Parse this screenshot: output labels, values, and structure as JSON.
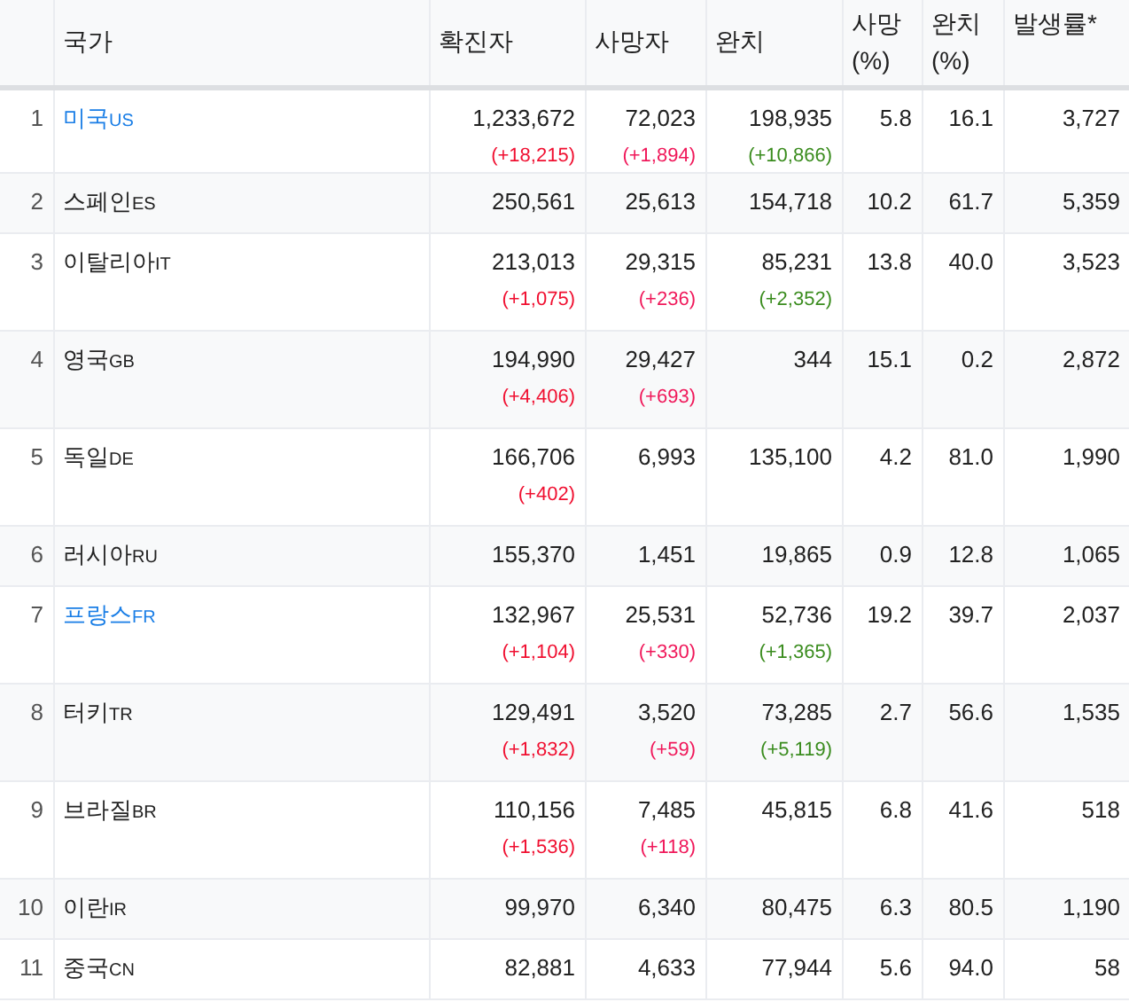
{
  "columns": [
    {},
    {
      "label": "국가"
    },
    {
      "label": "확진자"
    },
    {
      "label": "사망자"
    },
    {
      "label": "완치"
    },
    {
      "label": "사망 (%)"
    },
    {
      "label": "완치 (%)"
    },
    {
      "label": "발생률*"
    }
  ],
  "rows": [
    {
      "rank": "1",
      "name": "미국",
      "code": "US",
      "link": true,
      "cases": "1,233,672",
      "cases_new": "(+18,215)",
      "deaths": "72,023",
      "deaths_new": "(+1,894)",
      "recovered": "198,935",
      "recovered_new": "(+10,866)",
      "death_pct": "5.8",
      "recovered_pct": "16.1",
      "rate": "3,727"
    },
    {
      "rank": "2",
      "name": "스페인",
      "code": "ES",
      "link": false,
      "cases": "250,561",
      "deaths": "25,613",
      "recovered": "154,718",
      "death_pct": "10.2",
      "recovered_pct": "61.7",
      "rate": "5,359"
    },
    {
      "rank": "3",
      "name": "이탈리아",
      "code": "IT",
      "link": false,
      "cases": "213,013",
      "cases_new": "(+1,075)",
      "deaths": "29,315",
      "deaths_new": "(+236)",
      "recovered": "85,231",
      "recovered_new": "(+2,352)",
      "death_pct": "13.8",
      "recovered_pct": "40.0",
      "rate": "3,523"
    },
    {
      "rank": "4",
      "name": "영국",
      "code": "GB",
      "link": false,
      "cases": "194,990",
      "cases_new": "(+4,406)",
      "deaths": "29,427",
      "deaths_new": "(+693)",
      "recovered": "344",
      "death_pct": "15.1",
      "recovered_pct": "0.2",
      "rate": "2,872"
    },
    {
      "rank": "5",
      "name": "독일",
      "code": "DE",
      "link": false,
      "cases": "166,706",
      "cases_new": "(+402)",
      "deaths": "6,993",
      "recovered": "135,100",
      "death_pct": "4.2",
      "recovered_pct": "81.0",
      "rate": "1,990"
    },
    {
      "rank": "6",
      "name": "러시아",
      "code": "RU",
      "link": false,
      "cases": "155,370",
      "deaths": "1,451",
      "recovered": "19,865",
      "death_pct": "0.9",
      "recovered_pct": "12.8",
      "rate": "1,065"
    },
    {
      "rank": "7",
      "name": "프랑스",
      "code": "FR",
      "link": true,
      "cases": "132,967",
      "cases_new": "(+1,104)",
      "deaths": "25,531",
      "deaths_new": "(+330)",
      "recovered": "52,736",
      "recovered_new": "(+1,365)",
      "death_pct": "19.2",
      "recovered_pct": "39.7",
      "rate": "2,037"
    },
    {
      "rank": "8",
      "name": "터키",
      "code": "TR",
      "link": false,
      "cases": "129,491",
      "cases_new": "(+1,832)",
      "deaths": "3,520",
      "deaths_new": "(+59)",
      "recovered": "73,285",
      "recovered_new": "(+5,119)",
      "death_pct": "2.7",
      "recovered_pct": "56.6",
      "rate": "1,535"
    },
    {
      "rank": "9",
      "name": "브라질",
      "code": "BR",
      "link": false,
      "cases": "110,156",
      "cases_new": "(+1,536)",
      "deaths": "7,485",
      "deaths_new": "(+118)",
      "recovered": "45,815",
      "death_pct": "6.8",
      "recovered_pct": "41.6",
      "rate": "518"
    },
    {
      "rank": "10",
      "name": "이란",
      "code": "IR",
      "link": false,
      "cases": "99,970",
      "deaths": "6,340",
      "recovered": "80,475",
      "death_pct": "6.3",
      "recovered_pct": "80.5",
      "rate": "1,190"
    },
    {
      "rank": "11",
      "name": "중국",
      "code": "CN",
      "link": false,
      "cases": "82,881",
      "deaths": "4,633",
      "recovered": "77,944",
      "death_pct": "5.6",
      "recovered_pct": "94.0",
      "rate": "58"
    }
  ]
}
